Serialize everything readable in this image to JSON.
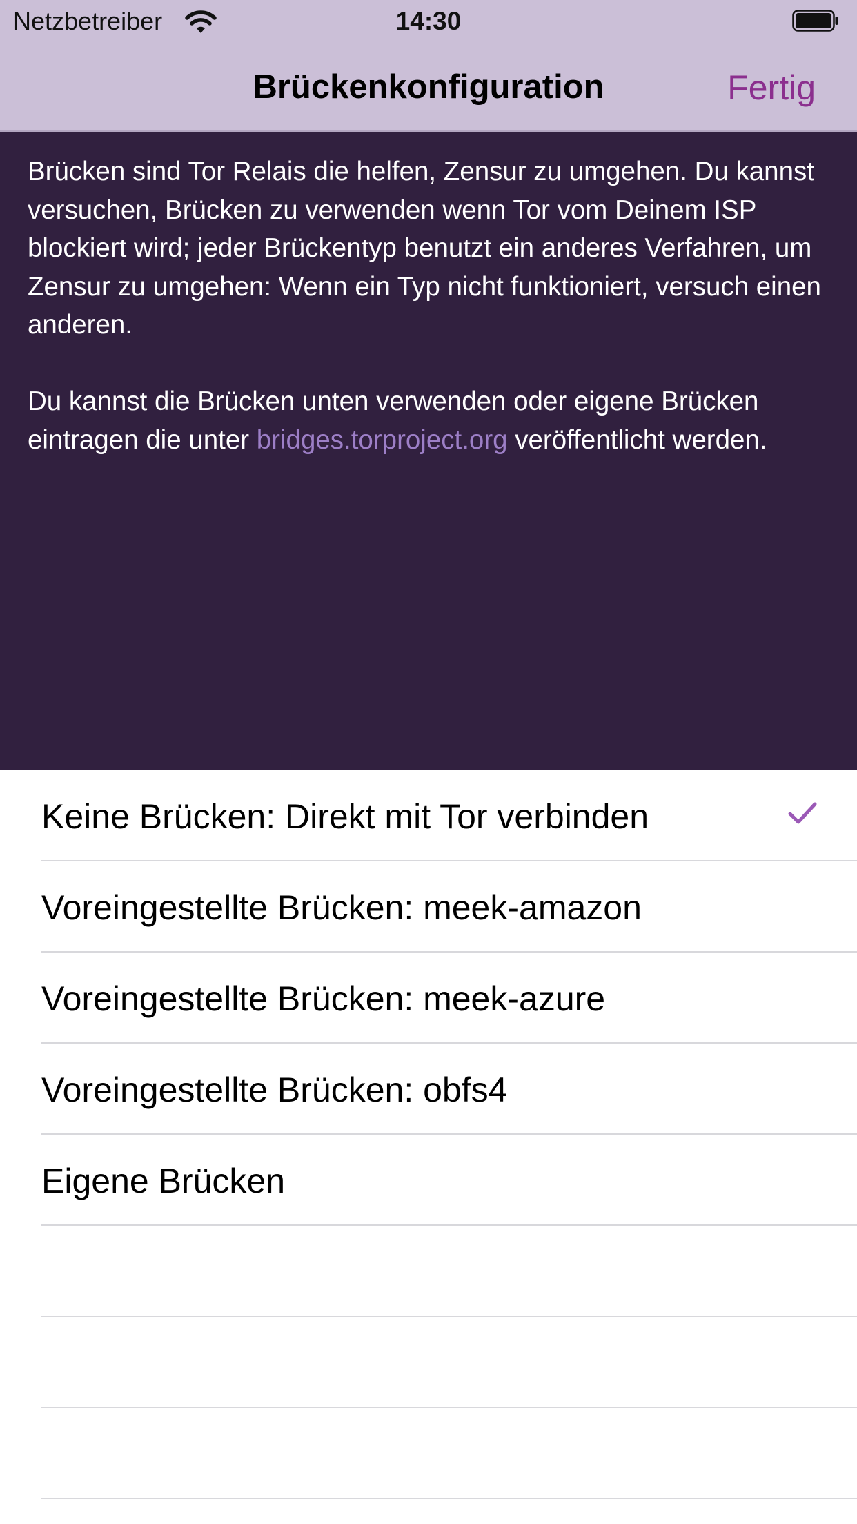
{
  "status_bar": {
    "carrier": "Netzbetreiber",
    "time": "14:30",
    "wifi_icon": "wifi-icon",
    "battery_icon": "battery-full-icon"
  },
  "nav": {
    "title": "Brückenkonfiguration",
    "done_label": "Fertig"
  },
  "info": {
    "paragraph1": "Brücken sind Tor Relais die helfen, Zensur zu umgehen. Du kannst versuchen, Brücken zu verwenden wenn Tor vom Deinem ISP blockiert wird; jeder Brückentyp benutzt ein anderes Verfahren, um Zensur zu umgehen: Wenn ein Typ nicht funktioniert, versuch einen anderen.",
    "paragraph2_before": "Du kannst die Brücken unten verwenden oder eigene Brücken eintragen die unter ",
    "link": "bridges.torproject.org",
    "paragraph2_after": " veröffentlicht werden."
  },
  "options": [
    {
      "label": "Keine Brücken: Direkt mit Tor verbinden",
      "selected": true
    },
    {
      "label": "Voreingestellte Brücken: meek-amazon",
      "selected": false
    },
    {
      "label": "Voreingestellte Brücken: meek-azure",
      "selected": false
    },
    {
      "label": "Voreingestellte Brücken: obfs4",
      "selected": false
    },
    {
      "label": "Eigene Brücken",
      "selected": false
    }
  ],
  "colors": {
    "nav_background": "#cbbfd7",
    "info_background": "#31203f",
    "accent": "#8b2f8e",
    "link": "#9d7fc7",
    "checkmark": "#9b59b6"
  }
}
